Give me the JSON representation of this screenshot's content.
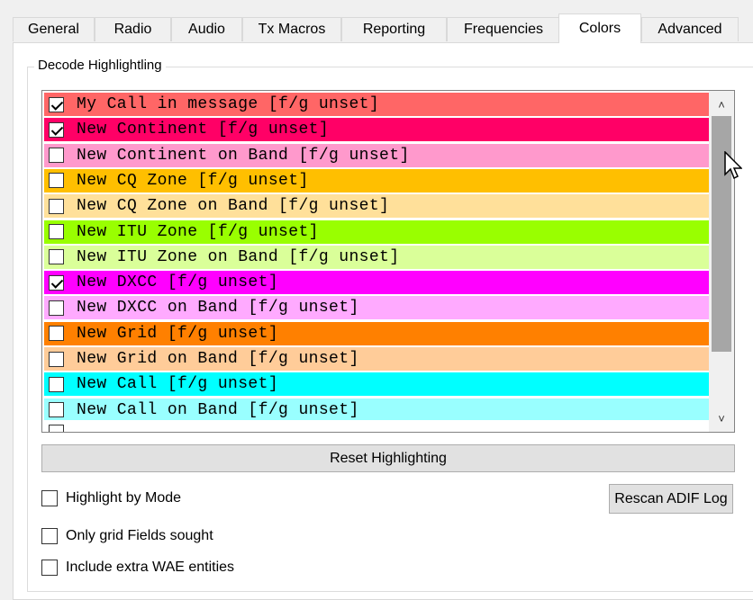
{
  "tabs": [
    {
      "label": "General",
      "active": false
    },
    {
      "label": "Radio",
      "active": false
    },
    {
      "label": "Audio",
      "active": false
    },
    {
      "label": "Tx Macros",
      "active": false
    },
    {
      "label": "Reporting",
      "active": false
    },
    {
      "label": "Frequencies",
      "active": false
    },
    {
      "label": "Colors",
      "active": true
    },
    {
      "label": "Advanced",
      "active": false
    }
  ],
  "group": {
    "title": "Decode Highlightling",
    "items": [
      {
        "label": "My Call in message [f/g unset]",
        "checked": true,
        "color": "#ff6666"
      },
      {
        "label": "New Continent [f/g unset]",
        "checked": true,
        "color": "#ff0066"
      },
      {
        "label": "New Continent on Band [f/g unset]",
        "checked": false,
        "color": "#ff99cc"
      },
      {
        "label": "New CQ Zone [f/g unset]",
        "checked": false,
        "color": "#ffbf00"
      },
      {
        "label": "New CQ Zone on Band [f/g unset]",
        "checked": false,
        "color": "#ffe09a"
      },
      {
        "label": "New ITU Zone [f/g unset]",
        "checked": false,
        "color": "#99ff00"
      },
      {
        "label": "New ITU Zone on Band [f/g unset]",
        "checked": false,
        "color": "#daff99"
      },
      {
        "label": "New DXCC [f/g unset]",
        "checked": true,
        "color": "#ff00ff"
      },
      {
        "label": "New DXCC on Band [f/g unset]",
        "checked": false,
        "color": "#ffaaff"
      },
      {
        "label": "New Grid [f/g unset]",
        "checked": false,
        "color": "#ff8000"
      },
      {
        "label": "New Grid on Band [f/g unset]",
        "checked": false,
        "color": "#ffcc99"
      },
      {
        "label": "New Call [f/g unset]",
        "checked": false,
        "color": "#00ffff"
      },
      {
        "label": "New Call on Band [f/g unset]",
        "checked": false,
        "color": "#99ffff"
      }
    ],
    "reset_label": "Reset Highlighting",
    "rescan_label": "Rescan ADIF Log",
    "options": [
      {
        "label": "Highlight by Mode",
        "checked": false
      },
      {
        "label": "Only grid Fields sought",
        "checked": false
      },
      {
        "label": "Include extra WAE entities",
        "checked": false
      }
    ]
  },
  "icons": {
    "scroll_up": "chevron-up-icon",
    "scroll_down": "chevron-down-icon",
    "cursor": "mouse-pointer-icon"
  }
}
